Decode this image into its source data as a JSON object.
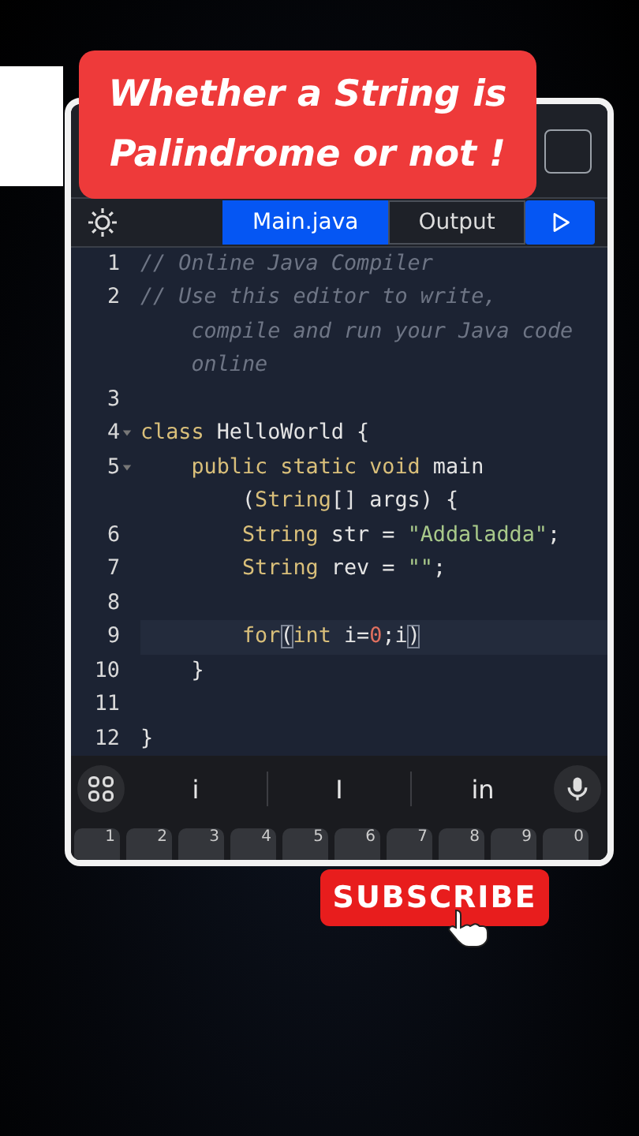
{
  "title_banner": {
    "lines": [
      "Whether a String is",
      "Palindrome or not !"
    ]
  },
  "editor": {
    "tabs": [
      {
        "label": "Main.java",
        "selected": true
      },
      {
        "label": "Output",
        "selected": false
      }
    ],
    "lines": [
      {
        "number": "1",
        "foldable": false,
        "active": false,
        "rows": [
          [
            {
              "kind": "comment",
              "text": "// Online Java Compiler"
            }
          ]
        ]
      },
      {
        "number": "2",
        "foldable": false,
        "active": false,
        "rows": [
          [
            {
              "kind": "comment",
              "text": "// Use this editor to write,"
            }
          ],
          [
            {
              "kind": "comment",
              "text": "compile and run your Java code"
            }
          ],
          [
            {
              "kind": "comment",
              "text": "online"
            }
          ]
        ]
      },
      {
        "number": "3",
        "foldable": false,
        "active": false,
        "rows": [
          []
        ]
      },
      {
        "number": "4",
        "foldable": true,
        "active": false,
        "rows": [
          [
            {
              "kind": "keyword",
              "text": "class"
            },
            {
              "kind": "plain",
              "text": " HelloWorld {"
            }
          ]
        ]
      },
      {
        "number": "5",
        "foldable": true,
        "active": false,
        "rows": [
          [
            {
              "kind": "plain",
              "text": "    "
            },
            {
              "kind": "keyword",
              "text": "public static void"
            },
            {
              "kind": "plain",
              "text": " main"
            }
          ],
          [
            {
              "kind": "plain",
              "text": "    ("
            },
            {
              "kind": "keyword",
              "text": "String"
            },
            {
              "kind": "plain",
              "text": "[] args) {"
            }
          ]
        ]
      },
      {
        "number": "6",
        "foldable": false,
        "active": false,
        "rows": [
          [
            {
              "kind": "plain",
              "text": "        "
            },
            {
              "kind": "keyword",
              "text": "String"
            },
            {
              "kind": "plain",
              "text": " str = "
            },
            {
              "kind": "string",
              "text": "\"Addaladda\""
            },
            {
              "kind": "plain",
              "text": ";"
            }
          ]
        ]
      },
      {
        "number": "7",
        "foldable": false,
        "active": false,
        "rows": [
          [
            {
              "kind": "plain",
              "text": "        "
            },
            {
              "kind": "keyword",
              "text": "String"
            },
            {
              "kind": "plain",
              "text": " rev = "
            },
            {
              "kind": "string",
              "text": "\"\""
            },
            {
              "kind": "plain",
              "text": ";"
            }
          ]
        ]
      },
      {
        "number": "8",
        "foldable": false,
        "active": false,
        "rows": [
          []
        ]
      },
      {
        "number": "9",
        "foldable": false,
        "active": true,
        "rows": [
          [
            {
              "kind": "plain",
              "text": "        "
            },
            {
              "kind": "keyword",
              "text": "for"
            },
            {
              "kind": "bracket",
              "text": "("
            },
            {
              "kind": "keyword",
              "text": "int"
            },
            {
              "kind": "plain",
              "text": " i="
            },
            {
              "kind": "number",
              "text": "0"
            },
            {
              "kind": "plain",
              "text": ";i"
            },
            {
              "kind": "bracket",
              "text": ")"
            }
          ]
        ]
      },
      {
        "number": "10",
        "foldable": false,
        "active": false,
        "rows": [
          [
            {
              "kind": "plain",
              "text": "    }"
            }
          ]
        ]
      },
      {
        "number": "11",
        "foldable": false,
        "active": false,
        "rows": [
          []
        ]
      },
      {
        "number": "12",
        "foldable": false,
        "active": false,
        "rows": [
          [
            {
              "kind": "plain",
              "text": "}"
            }
          ]
        ]
      }
    ]
  },
  "keyboard": {
    "suggestions": [
      "i",
      "I",
      "in"
    ],
    "key_hints": [
      "1",
      "2",
      "3",
      "4",
      "5",
      "6",
      "7",
      "8",
      "9",
      "0"
    ]
  },
  "subscribe_button": {
    "label": "SUBSCRIBE"
  }
}
